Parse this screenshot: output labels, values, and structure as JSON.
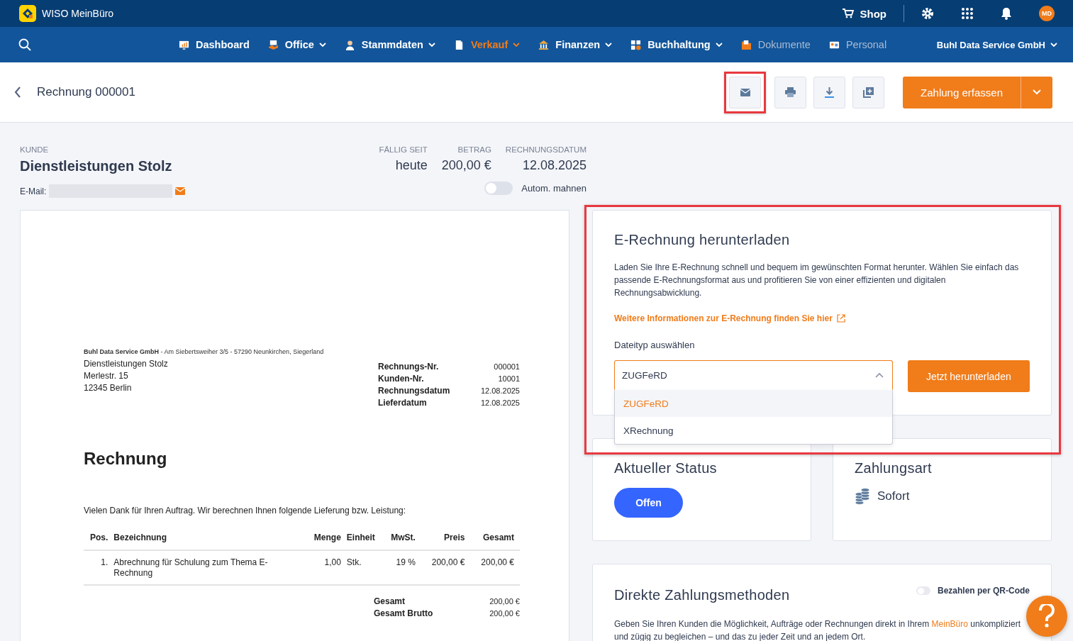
{
  "app": {
    "name": "WISO MeinBüro"
  },
  "topbar": {
    "shop": "Shop",
    "avatar": "MD"
  },
  "nav": {
    "items": [
      {
        "label": "Dashboard",
        "selected": false,
        "dropdown": false,
        "disabled": false
      },
      {
        "label": "Office",
        "selected": false,
        "dropdown": true,
        "disabled": false
      },
      {
        "label": "Stammdaten",
        "selected": false,
        "dropdown": true,
        "disabled": false
      },
      {
        "label": "Verkauf",
        "selected": true,
        "dropdown": true,
        "disabled": false
      },
      {
        "label": "Finanzen",
        "selected": false,
        "dropdown": true,
        "disabled": false
      },
      {
        "label": "Buchhaltung",
        "selected": false,
        "dropdown": true,
        "disabled": false
      },
      {
        "label": "Dokumente",
        "selected": false,
        "dropdown": false,
        "disabled": true
      },
      {
        "label": "Personal",
        "selected": false,
        "dropdown": false,
        "disabled": true
      }
    ],
    "company": "Buhl Data Service GmbH"
  },
  "header": {
    "title": "Rechnung 000001",
    "pay_button": "Zahlung erfassen"
  },
  "customer": {
    "label": "KUNDE",
    "name": "Dienstleistungen Stolz",
    "email_label": "E-Mail:"
  },
  "summary": [
    {
      "label": "FÄLLIG SEIT",
      "value": "heute"
    },
    {
      "label": "BETRAG",
      "value": "200,00 €"
    },
    {
      "label": "RECHNUNGSDATUM",
      "value": "12.08.2025"
    }
  ],
  "auto_remind": {
    "label": "Autom. mahnen",
    "on": false
  },
  "document": {
    "sender": "**Buhl Data Service GmbH** - Am Siebertsweiher 3/5 - 57290 Neunkirchen, Siegerland",
    "address": [
      "Dienstleistungen Stolz",
      "Merlestr. 15",
      "12345 Berlin"
    ],
    "meta": [
      {
        "label": "Rechnungs-Nr.",
        "value": "000001"
      },
      {
        "label": "Kunden-Nr.",
        "value": "10001"
      },
      {
        "label": "Rechnungsdatum",
        "value": "12.08.2025"
      },
      {
        "label": "Lieferdatum",
        "value": "12.08.2025"
      }
    ],
    "title": "Rechnung",
    "intro": "Vielen Dank für Ihren Auftrag. Wir berechnen Ihnen folgende Lieferung bzw. Leistung:",
    "columns": [
      "Pos.",
      "Bezeichnung",
      "Menge",
      "Einheit",
      "MwSt.",
      "Preis",
      "Gesamt"
    ],
    "rows": [
      [
        "1.",
        "Abrechnung für Schulung zum Thema E-Rechnung",
        "1,00",
        "Stk.",
        "19 %",
        "200,00 €",
        "200,00 €"
      ]
    ],
    "totals": [
      {
        "label": "Gesamt",
        "value": "200,00 €"
      },
      {
        "label": "Gesamt Brutto",
        "value": "200,00 €"
      }
    ]
  },
  "e_invoice": {
    "title": "E-Rechnung herunterladen",
    "description": "Laden Sie Ihre E-Rechnung schnell und bequem im gewünschten Format herunter. Wählen Sie einfach das passende E-Rechnungsformat aus und profitieren Sie von einer effizienten und digitalen Rechnungsabwicklung.",
    "link": "Weitere Informationen zur E-Rechnung finden Sie hier",
    "filetype_label": "Dateityp auswählen",
    "select": {
      "value": "ZUGFeRD",
      "expanded": true,
      "options": [
        {
          "label": "ZUGFeRD",
          "selected": true
        },
        {
          "label": "XRechnung",
          "selected": false
        }
      ]
    },
    "button": "Jetzt herunterladen"
  },
  "status": {
    "title": "Aktueller Status",
    "value": "Offen"
  },
  "payment_type": {
    "title": "Zahlungsart",
    "value": "Sofort"
  },
  "direct_payment": {
    "title": "Direkte Zahlungsmethoden",
    "qr": {
      "label": "Bezahlen per QR-Code",
      "on": false
    },
    "text_before": "Geben Sie Ihren Kunden die Möglichkeit, Aufträge oder Rechnungen direkt in Ihrem",
    "link": "MeinBüro",
    "text_after": "unkompliziert und zügig zu begleichen – und das zu jeder Zeit und an jedem Ort."
  }
}
